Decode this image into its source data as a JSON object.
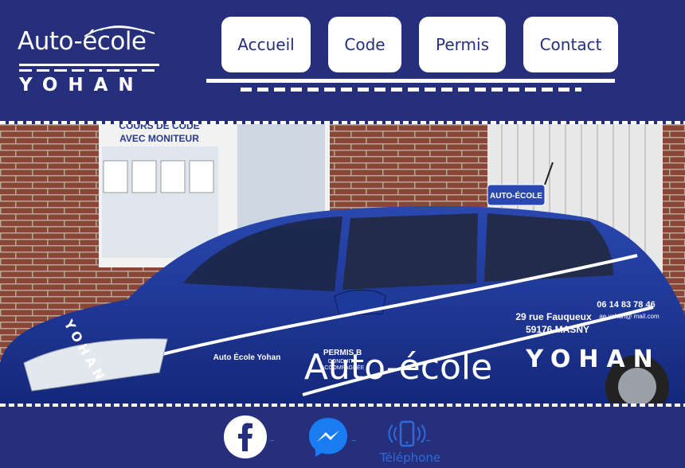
{
  "brand": {
    "title": "Auto-école",
    "subtitle": "YOHAN"
  },
  "nav": {
    "items": [
      {
        "label": "Accueil"
      },
      {
        "label": "Code"
      },
      {
        "label": "Permis"
      },
      {
        "label": "Contact"
      }
    ]
  },
  "hero": {
    "sign_text_line1": "COURS DE CODE",
    "sign_text_line2": "AVEC MONITEUR",
    "roof_sign": "AUTO-ÉCOLE",
    "car_logo_text": "Auto-école",
    "car_logo_sub": "YOHAN",
    "car_address_line1": "29 rue Fauqueux",
    "car_address_line2": "59176 MASNY",
    "car_phone": "06 14 83 78 46",
    "car_email": "ae.yohan@ mail.com",
    "car_facebook": "Auto École Yohan",
    "car_permis_line1": "PERMIS B",
    "car_permis_line2": "CONDUITE",
    "car_permis_line3": "ACCOMPAGNÉE",
    "car_hood_text": "YOHAN"
  },
  "footer": {
    "telephone_label": "Téléphone"
  },
  "colors": {
    "primary": "#252f7c",
    "white": "#ffffff",
    "link_blue": "#2f6bd8",
    "messenger_blue": "#1a7cf2",
    "brick": "#8a4a3a",
    "car_blue": "#1d3a9a"
  },
  "icons": [
    "facebook-icon",
    "messenger-icon",
    "phone-icon"
  ]
}
